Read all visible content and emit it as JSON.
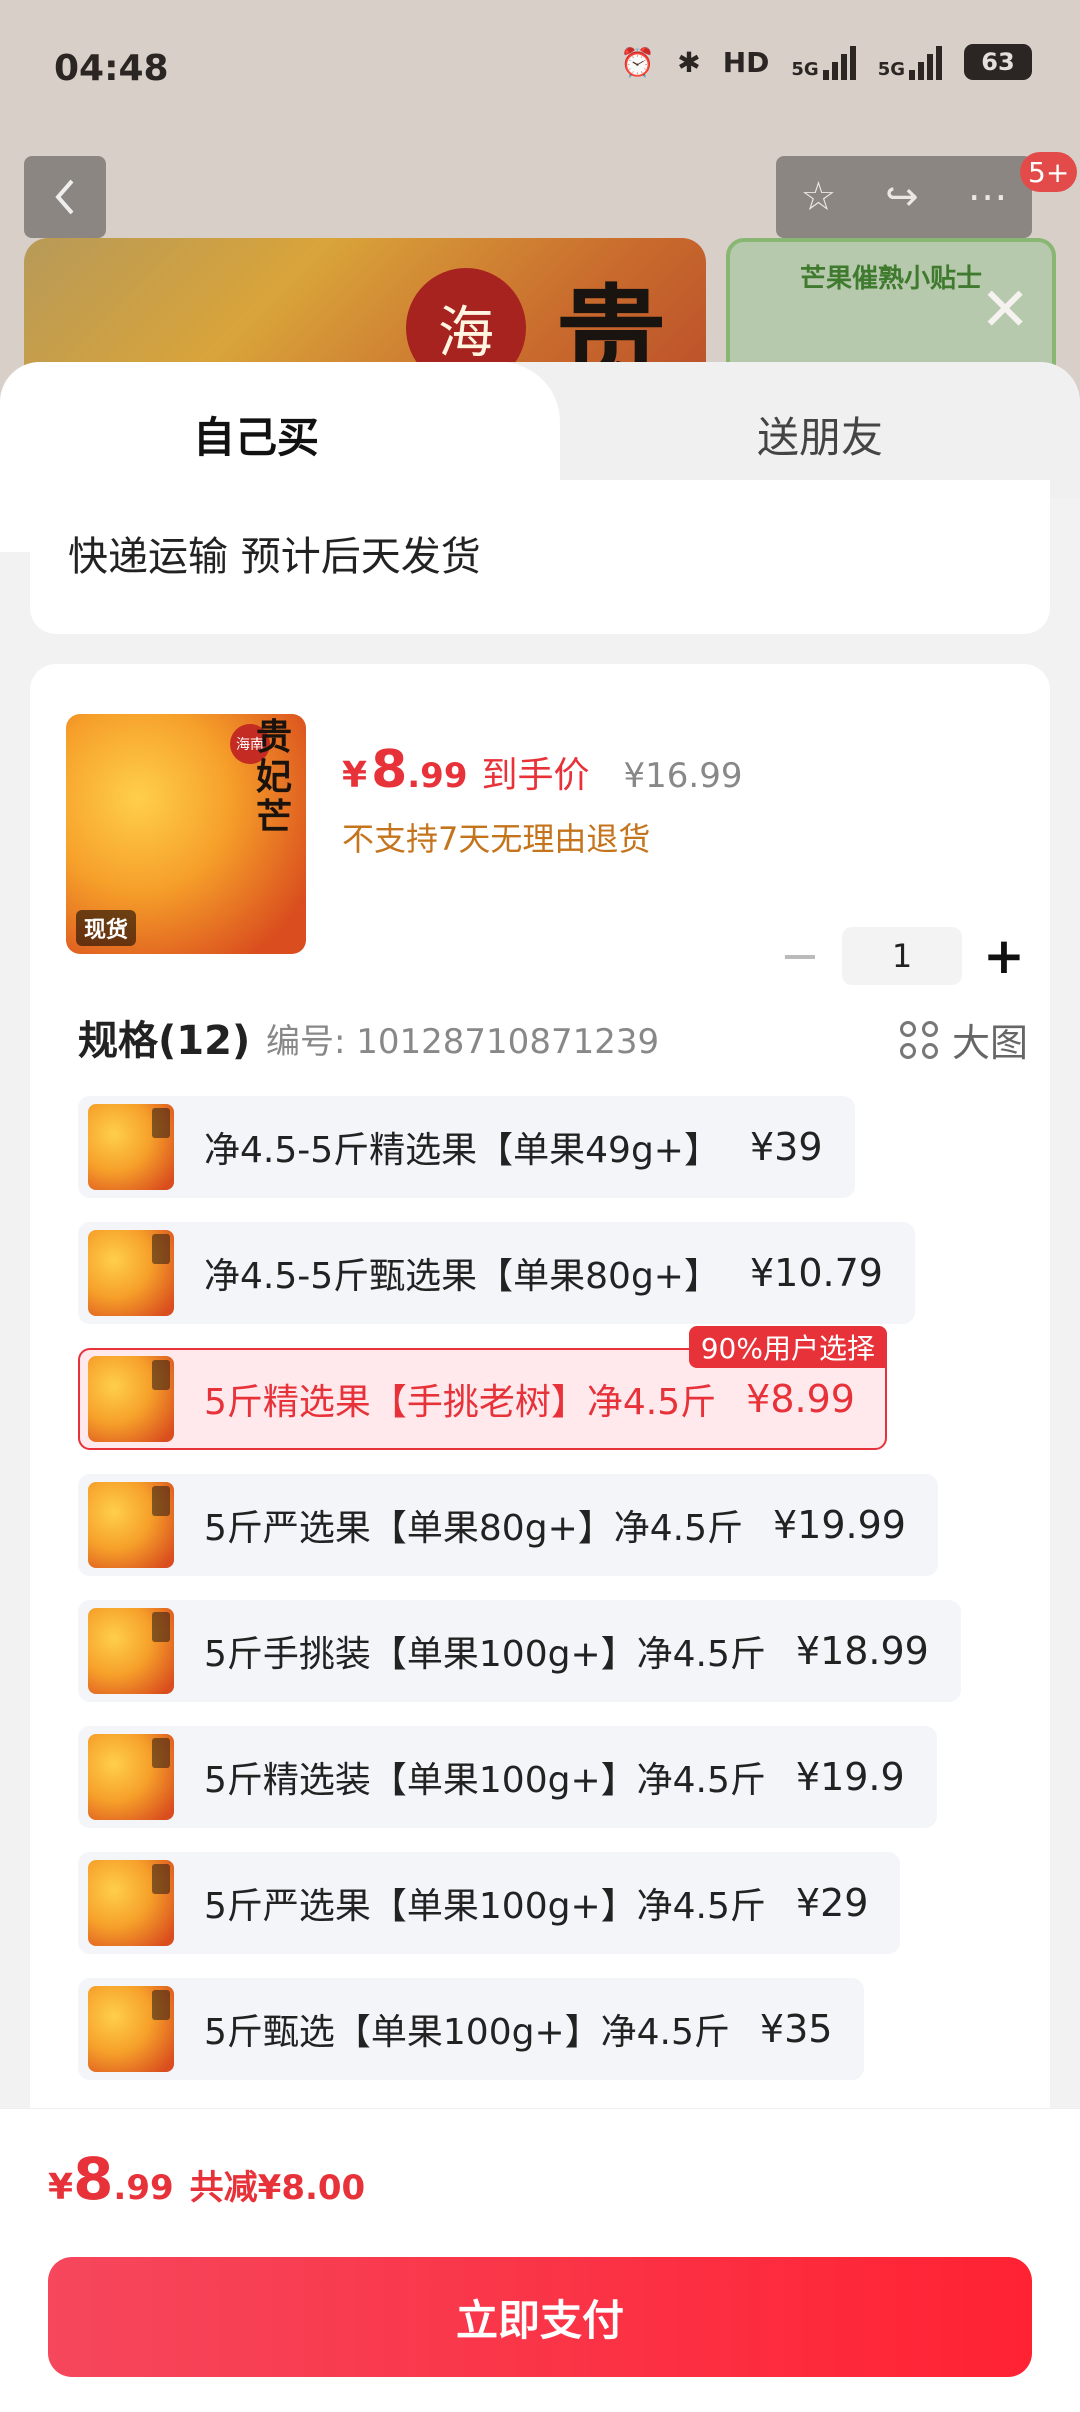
{
  "status_bar": {
    "time": "04:48",
    "icons": [
      "alarm-icon",
      "bluetooth-icon",
      "hd-icon",
      "signal-5g-icon",
      "signal-5g-icon",
      "battery-icon"
    ],
    "hd_label": "HD",
    "net1": "5G",
    "net2": "5G",
    "battery": "63"
  },
  "background": {
    "notification_badge": "5+",
    "hero_title": "贵",
    "hero_seal": "海",
    "tip_card_title": "芒果催熟小贴士"
  },
  "tabs": {
    "self_buy": "自己买",
    "gift_friend": "送朋友"
  },
  "shipping": {
    "text": "快递运输 预计后天发货"
  },
  "product": {
    "thumb_seal": "海南",
    "thumb_name": "贵妃芒",
    "thumb_tag": "现货",
    "price_currency": "¥",
    "price_int": "8",
    "price_dec": ".99",
    "price_tag": "到手价",
    "original_price": "¥16.99",
    "return_policy": "不支持7天无理由退货",
    "quantity": "1"
  },
  "spec": {
    "title": "规格(12)",
    "code": "编号: 10128710871239",
    "big_view_label": "大图",
    "items": [
      {
        "name": "净4.5-5斤精选果【单果49g+】",
        "price": "¥39",
        "selected": false,
        "badge": ""
      },
      {
        "name": "净4.5-5斤甄选果【单果80g+】",
        "price": "¥10.79",
        "selected": false,
        "badge": ""
      },
      {
        "name": "5斤精选果【手挑老树】净4.5斤",
        "price": "¥8.99",
        "selected": true,
        "badge": "90%用户选择"
      },
      {
        "name": "5斤严选果【单果80g+】净4.5斤",
        "price": "¥19.99",
        "selected": false,
        "badge": ""
      },
      {
        "name": "5斤手挑装【单果100g+】净4.5斤",
        "price": "¥18.99",
        "selected": false,
        "badge": ""
      },
      {
        "name": "5斤精选装【单果100g+】净4.5斤",
        "price": "¥19.9",
        "selected": false,
        "badge": ""
      },
      {
        "name": "5斤严选果【单果100g+】净4.5斤",
        "price": "¥29",
        "selected": false,
        "badge": ""
      },
      {
        "name": "5斤甄选【单果100g+】净4.5斤",
        "price": "¥35",
        "selected": false,
        "badge": ""
      }
    ]
  },
  "footer": {
    "total_currency": "¥",
    "total_int": "8",
    "total_dec": ".99",
    "saving": "共减¥8.00",
    "pay_button": "立即支付"
  },
  "colors": {
    "accent": "#e8323a",
    "warning": "#c4741c",
    "selected_bg": "#ffe9ec"
  }
}
